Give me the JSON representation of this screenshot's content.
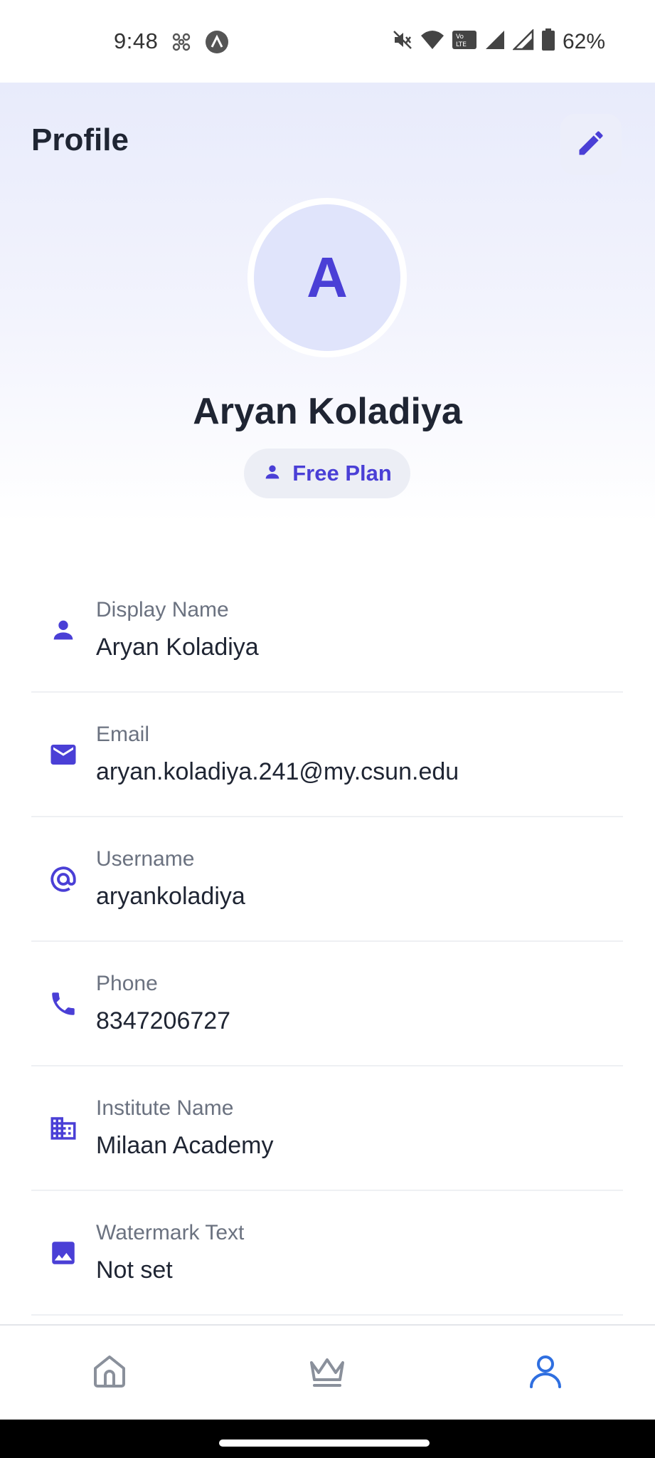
{
  "status_bar": {
    "time": "9:48",
    "battery": "62%",
    "icons": [
      "fan-icon",
      "app-icon",
      "mute-icon",
      "wifi-icon",
      "volte-icon",
      "signal-icon",
      "signal-roaming-icon",
      "battery-icon"
    ]
  },
  "header": {
    "title": "Profile",
    "edit_icon": "pencil-icon"
  },
  "profile": {
    "avatar_initial": "A",
    "name": "Aryan Koladiya",
    "plan": "Free Plan",
    "plan_icon": "person-icon"
  },
  "fields": [
    {
      "label": "Display Name",
      "value": "Aryan Koladiya",
      "icon": "person-icon"
    },
    {
      "label": "Email",
      "value": "aryan.koladiya.241@my.csun.edu",
      "icon": "mail-icon"
    },
    {
      "label": "Username",
      "value": "aryankoladiya",
      "icon": "at-icon"
    },
    {
      "label": "Phone",
      "value": "8347206727",
      "icon": "phone-icon"
    },
    {
      "label": "Institute Name",
      "value": "Milaan Academy",
      "icon": "building-icon"
    },
    {
      "label": "Watermark Text",
      "value": "Not set",
      "icon": "image-icon"
    }
  ],
  "bottom_nav": [
    {
      "name": "home",
      "icon": "home-icon",
      "active": false
    },
    {
      "name": "premium",
      "icon": "crown-icon",
      "active": false
    },
    {
      "name": "profile",
      "icon": "user-icon",
      "active": true
    }
  ],
  "colors": {
    "accent": "#4a3fd6",
    "nav_active": "#2f6fe0",
    "nav_inactive": "#8a909b"
  }
}
